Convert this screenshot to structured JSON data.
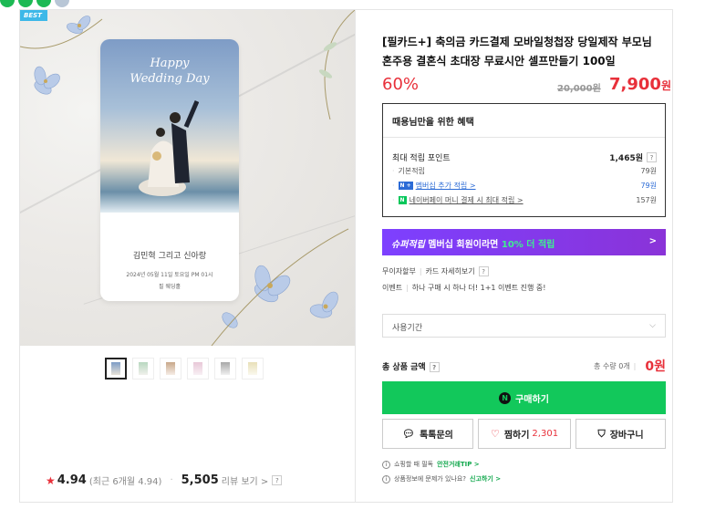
{
  "colors": {
    "accent_red": "#e8303a",
    "buy_green": "#12c85b",
    "membership_purple": "#7d40ff",
    "link_blue": "#2b6bd6"
  },
  "gallery": {
    "badge": "BEST",
    "card_title": "Happy\nWedding Day",
    "names": "김민혁 그리고 신아랑",
    "date": "2024년 05월 11일 토요일 PM 01시",
    "venue": "필 웨딩홀",
    "thumbnails": 6,
    "active_thumbnail": 1
  },
  "review": {
    "score": "4.94",
    "score_note": "(최근 6개월 4.94)",
    "count": "5,505",
    "count_label": "리뷰 보기 >",
    "help": "?"
  },
  "product": {
    "title": "[필카드+] 축의금 카드결제 모바일청첩장 당일제작 부모님 혼주용 결혼식 초대장 무료시안 셀프만들기 100일",
    "discount": "60%",
    "original_price": "20,000원",
    "price": "7,900",
    "price_unit": "원"
  },
  "benefit": {
    "heading": "때용님만을 위한 혜택",
    "max_points_label": "최대 적립 포인트",
    "max_points_value": "1,465원",
    "help": "?",
    "rows": [
      {
        "label": "기본적립",
        "value": "79원"
      },
      {
        "badge": "N +",
        "label": "멤버십 추가 적립 >",
        "value": "79원"
      },
      {
        "badge": "N",
        "label": "네이버페이 머니 결제 시 최대 적립 >",
        "value": "157원"
      }
    ]
  },
  "banner": {
    "strong": "슈퍼적립",
    "text": "멤버십 회원이라면",
    "highlight": "10% 더 적립",
    "arrow": ">"
  },
  "info": {
    "row1_a": "무이자할부",
    "row1_b": "카드 자세히보기",
    "row1_help": "?",
    "row2_a": "이벤트",
    "row2_b": "하나 구매 시 하나 더! 1+1 이벤트 진행 중!"
  },
  "option": {
    "label": "사용기간",
    "chevron": "⌵"
  },
  "total": {
    "label": "총 상품 금액",
    "help": "?",
    "qty": "총 수량 0개",
    "amount": "0원"
  },
  "actions": {
    "buy": "구매하기",
    "inquiry": "톡톡문의",
    "wish": "찜하기",
    "wish_count": "2,301",
    "cart": "장바구니"
  },
  "tips": {
    "tip1": "쇼핑할 때 필독",
    "tip1_link": "안전거래TIP >",
    "tip2": "상품정보에 문제가 있나요?",
    "tip2_link": "신고하기 >"
  }
}
